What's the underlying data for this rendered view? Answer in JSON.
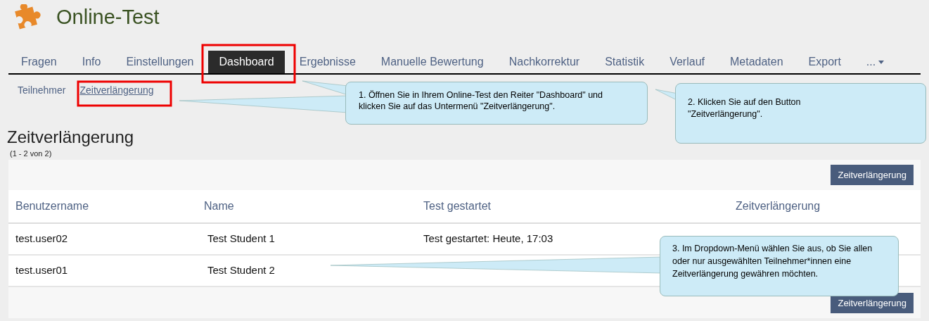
{
  "header": {
    "title": "Online-Test"
  },
  "tabs": [
    {
      "label": "Fragen",
      "selected": false
    },
    {
      "label": "Info",
      "selected": false
    },
    {
      "label": "Einstellungen",
      "selected": false
    },
    {
      "label": "Dashboard",
      "selected": true
    },
    {
      "label": "Ergebnisse",
      "selected": false
    },
    {
      "label": "Manuelle Bewertung",
      "selected": false
    },
    {
      "label": "Nachkorrektur",
      "selected": false
    },
    {
      "label": "Statistik",
      "selected": false
    },
    {
      "label": "Verlauf",
      "selected": false
    },
    {
      "label": "Metadaten",
      "selected": false
    },
    {
      "label": "Export",
      "selected": false
    },
    {
      "label": "...",
      "selected": false,
      "kind": "more"
    }
  ],
  "subtabs": [
    {
      "label": "Teilnehmer",
      "selected": false
    },
    {
      "label": "Zeitverlängerung",
      "selected": true
    }
  ],
  "heading": "Zeitverlängerung",
  "count": "(1 - 2 von 2)",
  "button": "Zeitverlängerung",
  "table": {
    "columns": [
      "Benutzername",
      "Name",
      "Test gestartet",
      "Zeitverlängerung"
    ],
    "rows": [
      [
        "test.user02",
        "Test Student 1",
        "Test gestartet: Heute, 17:03"
      ],
      [
        "test.user01",
        "Test Student 2"
      ]
    ]
  },
  "bottom_button": "Zeitverlängerung",
  "callouts": [
    "1. Öffnen Sie in Ihrem Online-Test den Reiter \"Dashboard\" und klicken Sie auf das Untermenü \"Zeitverlängerung\".",
    "2. Klicken Sie auf den Button \"Zeitverlängerung\".",
    "3. Im Dropdown-Menü wählen Sie aus, ob Sie allen oder nur ausgewählten Teilnehmer*innen eine Zeitverlängerung gewähren möchten."
  ]
}
